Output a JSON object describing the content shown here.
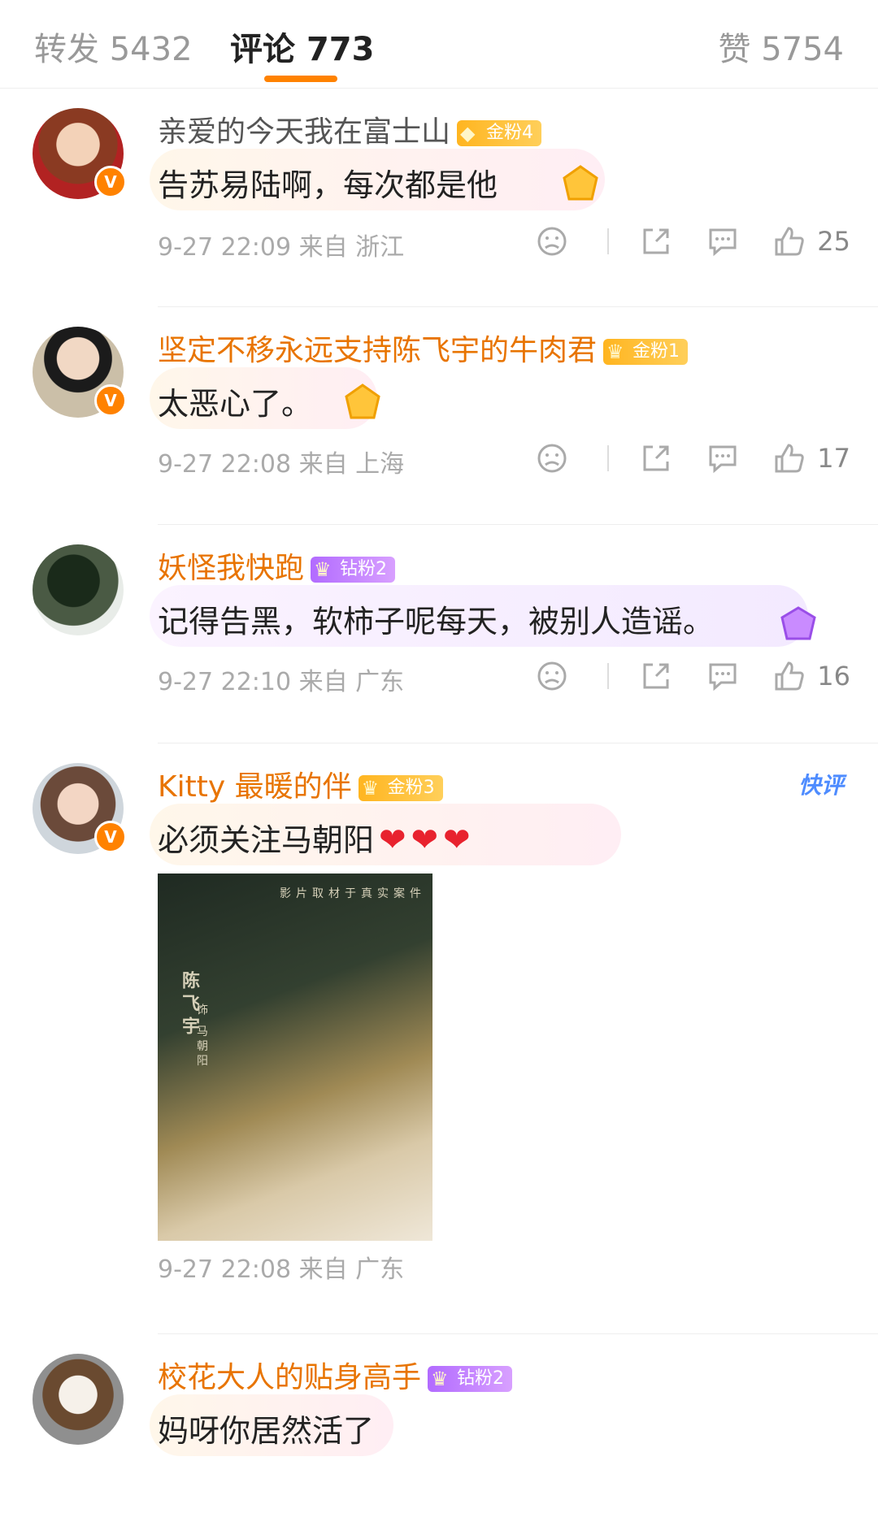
{
  "tabs": {
    "repost": {
      "label": "转发",
      "count": "5432"
    },
    "comment": {
      "label": "评论",
      "count": "773"
    },
    "like": {
      "label": "赞",
      "count": "5754"
    }
  },
  "colors": {
    "accent": "#ff8200",
    "username_member": "#e87400",
    "quick_comment": "#4e8cff"
  },
  "comments": [
    {
      "username": "亲爱的今天我在富士山",
      "badge": "金粉4",
      "text": "告苏易陆啊，每次都是他",
      "time": "9-27 22:09",
      "location": "来自 浙江",
      "likes": "25"
    },
    {
      "username": "坚定不移永远支持陈飞宇的牛肉君",
      "badge": "金粉1",
      "text": "太恶心了。",
      "time": "9-27 22:08",
      "location": "来自 上海",
      "likes": "17"
    },
    {
      "username": "妖怪我快跑",
      "badge": "钻粉2",
      "text": "记得告黑，软柿子呢每天，被别人造谣。",
      "time": "9-27 22:10",
      "location": "来自 广东",
      "likes": "16"
    },
    {
      "username": "Kitty 最暖的伴",
      "badge": "金粉3",
      "text": "必须关注马朝阳",
      "quick_label": "快评",
      "poster_top": "影片取材于真实案件",
      "poster_name": "陈飞宇",
      "poster_role": "饰 马朝阳",
      "time": "9-27 22:08",
      "location": "来自 广东"
    },
    {
      "username": "校花大人的贴身高手",
      "badge": "钻粉2",
      "text": "妈呀你居然活了"
    }
  ]
}
